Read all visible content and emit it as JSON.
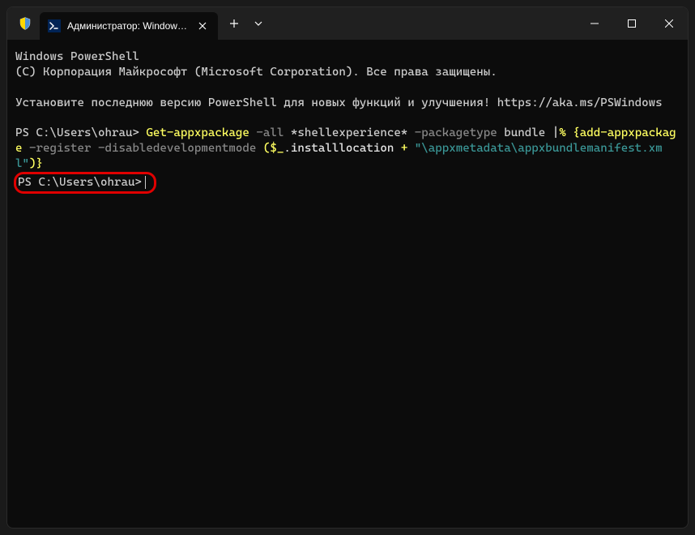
{
  "titlebar": {
    "tab_title": "Администратор: Windows Pc",
    "shield_icon": "admin-shield-icon",
    "ps_icon_text": ">_"
  },
  "terminal": {
    "line1": "Windows PowerShell",
    "line2": "(C) Корпорация Майкрософт (Microsoft Corporation). Все права защищены.",
    "line3": "Установите последнюю версию PowerShell для новых функций и улучшения! https://aka.ms/PSWindows",
    "prompt1": "PS C:\\Users\\ohrau> ",
    "cmd_part1": "Get-appxpackage",
    "cmd_flag1": " -all",
    "cmd_arg1": " *shellexperience*",
    "cmd_flag2": " -packagetype",
    "cmd_arg2": " bundle ",
    "cmd_pipe": "|",
    "cmd_percent": "% ",
    "cmd_brace1": "{",
    "cmd_part2": "add-appxpackage",
    "cmd_flag3": " -register -disabledevelopmentmode ",
    "cmd_paren1": "(",
    "cmd_var": "$_",
    "cmd_prop": ".installlocation ",
    "cmd_plus": "+",
    "cmd_str": " \"\\appxmetadata\\appxbundlemanifest.xml\"",
    "cmd_close": ")}",
    "prompt2": "PS C:\\Users\\ohrau>"
  }
}
